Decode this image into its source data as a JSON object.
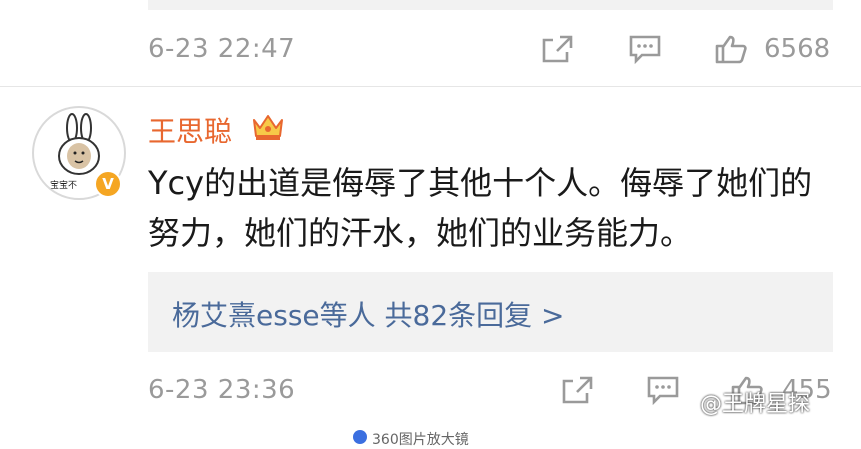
{
  "comment_1": {
    "timestamp": "6-23 22:47",
    "likes": "6568"
  },
  "comment_2": {
    "avatar_tag": "宝宝不",
    "username": "王思聪",
    "text": "Ycy的出道是侮辱了其他十个人。侮辱了她们的努力，她们的汗水，她们的业务能力。",
    "replies_summary": "杨艾熹esse等人  共82条回复 >",
    "timestamp": "6-23 23:36",
    "likes": "455"
  },
  "watermark": "@王牌星探",
  "bottom_label": "360图片放大镜"
}
